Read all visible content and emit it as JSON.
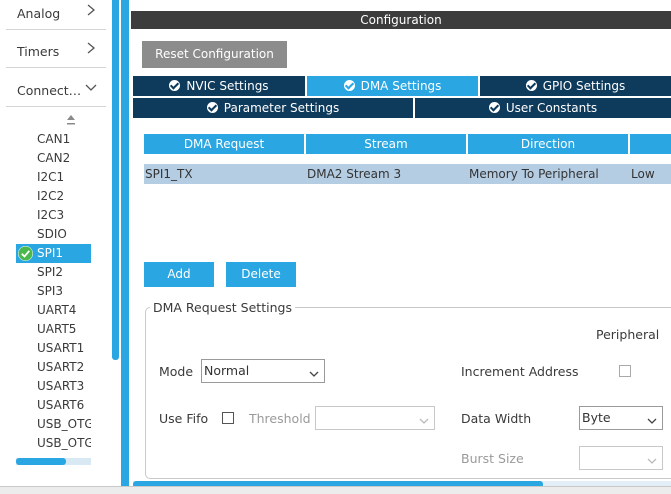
{
  "sidebar": {
    "categories": [
      {
        "label": "Analog",
        "icon": "chevron-right-icon"
      },
      {
        "label": "Timers",
        "icon": "chevron-right-icon"
      },
      {
        "label": "Connect…",
        "icon": "chevron-down-icon"
      }
    ],
    "sort_icon": "sort-arrow-icon",
    "peripherals": [
      {
        "label": "CAN1"
      },
      {
        "label": "CAN2"
      },
      {
        "label": "I2C1"
      },
      {
        "label": "I2C2"
      },
      {
        "label": "I2C3"
      },
      {
        "label": "SDIO"
      },
      {
        "label": "SPI1",
        "selected": true,
        "icon": "check-circle-icon"
      },
      {
        "label": "SPI2"
      },
      {
        "label": "SPI3"
      },
      {
        "label": "UART4"
      },
      {
        "label": "UART5"
      },
      {
        "label": "USART1"
      },
      {
        "label": "USART2"
      },
      {
        "label": "USART3"
      },
      {
        "label": "USART6"
      },
      {
        "label": "USB_OTG"
      },
      {
        "label": "USB_OTG"
      }
    ]
  },
  "config": {
    "title": "Configuration",
    "reset_label": "Reset Configuration",
    "tabs": [
      {
        "label": "NVIC Settings",
        "icon": "check-circle-icon"
      },
      {
        "label": "DMA Settings",
        "icon": "check-circle-icon",
        "active": true
      },
      {
        "label": "GPIO Settings",
        "icon": "check-circle-icon"
      },
      {
        "label": "Parameter Settings",
        "icon": "check-circle-icon"
      },
      {
        "label": "User Constants",
        "icon": "check-circle-icon"
      }
    ],
    "table": {
      "headers": [
        "DMA Request",
        "Stream",
        "Direction",
        ""
      ],
      "rows": [
        [
          "SPI1_TX",
          "DMA2 Stream 3",
          "Memory To Peripheral",
          "Low"
        ]
      ]
    },
    "add_label": "Add",
    "delete_label": "Delete",
    "request_settings": {
      "legend": "DMA Request Settings",
      "peripheral_label": "Peripheral",
      "mode_label": "Mode",
      "mode_value": "Normal",
      "increment_label": "Increment Address",
      "use_fifo_label": "Use Fifo",
      "threshold_label": "Threshold",
      "threshold_value": "",
      "data_width_label": "Data Width",
      "data_width_value": "Byte",
      "burst_size_label": "Burst Size",
      "burst_size_value": ""
    }
  },
  "colors": {
    "accent": "#2aa7e3",
    "tab_dark": "#0e3a5c",
    "title_bar": "#3c3c3c",
    "row_selected": "#b5cde3",
    "reset_button": "#8c8c8c"
  }
}
